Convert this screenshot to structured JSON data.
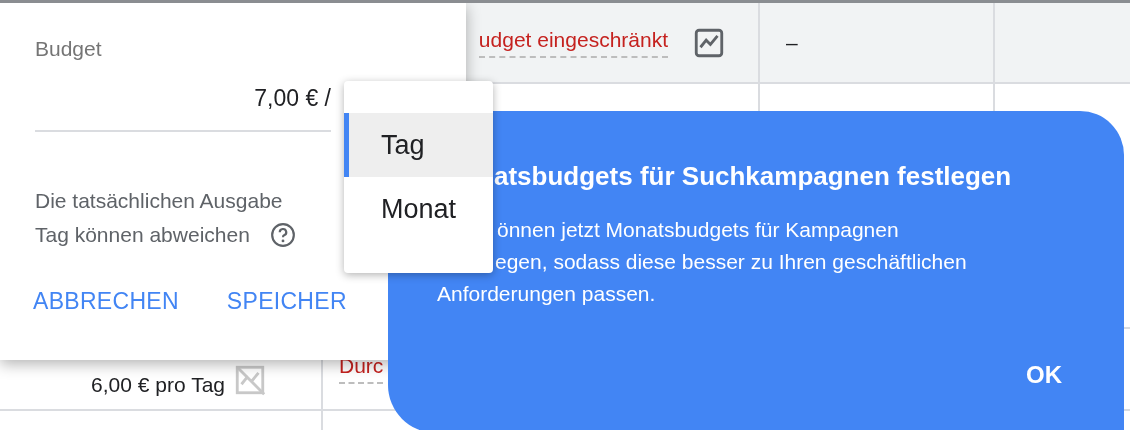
{
  "table": {
    "rows": [
      {
        "status": "udget eingeschränkt",
        "column_3": "–"
      },
      {
        "budget": "6,00 € pro Tag",
        "status": "Durc"
      }
    ]
  },
  "budget_editor": {
    "label": "Budget",
    "value": "7,00 € /",
    "note_lines": [
      "Die tatsächlichen Ausgabe",
      "Tag können abweichen"
    ],
    "buttons": [
      "ABBRECHEN",
      "SPEICHER"
    ]
  },
  "period_menu": {
    "items": [
      {
        "label": "Tag",
        "selected": true
      },
      {
        "label": "Monat",
        "selected": false
      }
    ]
  },
  "tooltip": {
    "title": "atsbudgets für Suchkampagnen festlegen",
    "body_lines": [
      "önnen jetzt Monatsbudgets für Kampagnen",
      "egen, sodass diese besser zu Ihren geschäftlichen",
      "Anforderungen passen."
    ],
    "button": "OK"
  }
}
